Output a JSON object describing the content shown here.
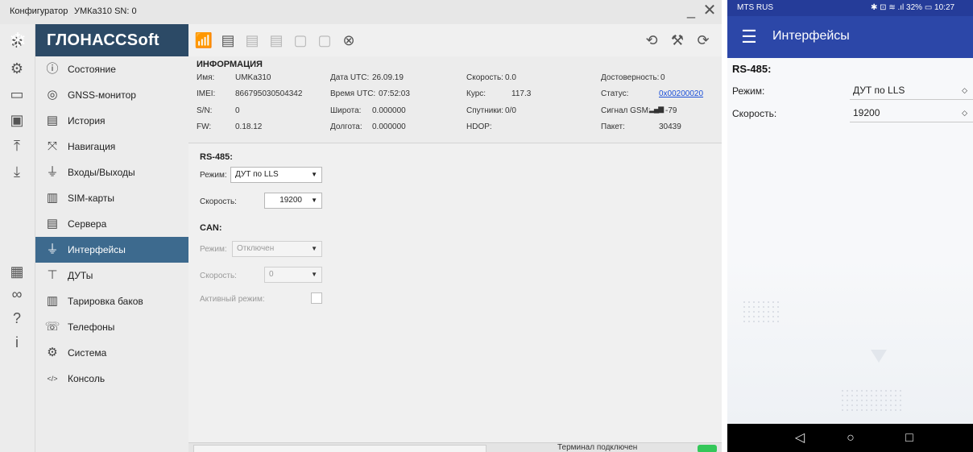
{
  "window": {
    "title_app": "Конфигуратор",
    "title_device": "УМКа310 SN: 0",
    "minimize_glyph": "_",
    "close_glyph": "✕"
  },
  "brand": {
    "name": "ГЛОНАССSoft",
    "logo_glyph": "❄"
  },
  "rail_icons": [
    {
      "name": "bluetooth-icon",
      "glyph": "✱"
    },
    {
      "name": "usb-icon",
      "glyph": "⚙"
    },
    {
      "name": "folder-icon",
      "glyph": "▭"
    },
    {
      "name": "save-icon",
      "glyph": "▣"
    },
    {
      "name": "upload-icon",
      "glyph": "⤒"
    },
    {
      "name": "download-icon",
      "glyph": "⤓"
    },
    {
      "name": "grid-icon",
      "glyph": "▦"
    },
    {
      "name": "link-icon",
      "glyph": "∞"
    },
    {
      "name": "help-icon",
      "glyph": "?"
    },
    {
      "name": "about-icon",
      "glyph": "i"
    }
  ],
  "sidebar": {
    "items": [
      {
        "label": "Состояние",
        "icon": "info-icon",
        "glyph": "ⓘ"
      },
      {
        "label": "GNSS-монитор",
        "icon": "satellite-icon",
        "glyph": "◎"
      },
      {
        "label": "История",
        "icon": "book-icon",
        "glyph": "▤"
      },
      {
        "label": "Навигация",
        "icon": "navigation-icon",
        "glyph": "⤧"
      },
      {
        "label": "Входы/Выходы",
        "icon": "io-icon",
        "glyph": "⏚"
      },
      {
        "label": "SIM-карты",
        "icon": "sim-icon",
        "glyph": "▥"
      },
      {
        "label": "Сервера",
        "icon": "server-icon",
        "glyph": "▤"
      },
      {
        "label": "Интерфейсы",
        "icon": "interface-icon",
        "glyph": "⏚"
      },
      {
        "label": "ДУТы",
        "icon": "sensor-icon",
        "glyph": "⊤"
      },
      {
        "label": "Тарировка баков",
        "icon": "tank-icon",
        "glyph": "▥"
      },
      {
        "label": "Телефоны",
        "icon": "phone-icon",
        "glyph": "☏"
      },
      {
        "label": "Система",
        "icon": "gear-icon",
        "glyph": "⚙"
      },
      {
        "label": "Консоль",
        "icon": "console-icon",
        "glyph": "</>"
      }
    ],
    "active_index": 7
  },
  "toolbar": {
    "left_icons": [
      {
        "name": "gsm-antenna-icon",
        "glyph": "📶",
        "dim": false
      },
      {
        "name": "read-config-icon",
        "glyph": "▤",
        "dim": false
      },
      {
        "name": "write-config-icon",
        "glyph": "▤",
        "dim": true
      },
      {
        "name": "apply-config-icon",
        "glyph": "▤",
        "dim": true
      },
      {
        "name": "db-read-icon",
        "glyph": "▢",
        "dim": true
      },
      {
        "name": "db-settings-icon",
        "glyph": "▢",
        "dim": true
      },
      {
        "name": "location-off-icon",
        "glyph": "⊗",
        "dim": false
      }
    ],
    "right_icons": [
      {
        "name": "reload-icon",
        "glyph": "⟲"
      },
      {
        "name": "firmware-icon",
        "glyph": "⚒"
      },
      {
        "name": "restore-icon",
        "glyph": "⟳"
      }
    ]
  },
  "info": {
    "title": "ИНФОРМАЦИЯ",
    "col1": [
      {
        "label": "Имя:",
        "value": "UMKa310"
      },
      {
        "label": "IMEI:",
        "value": "866795030504342"
      },
      {
        "label": "S/N:",
        "value": "0"
      },
      {
        "label": "FW:",
        "value": "0.18.12"
      }
    ],
    "col2": [
      {
        "label": "Дата UTC:",
        "value": "26.09.19"
      },
      {
        "label": "Время UTC:",
        "value": "07:52:03"
      },
      {
        "label": "Широта:",
        "value": "0.000000"
      },
      {
        "label": "Долгота:",
        "value": "0.000000"
      }
    ],
    "col3": [
      {
        "label": "Скорость:",
        "value": "0.0"
      },
      {
        "label": "Курс:",
        "value": "117.3"
      },
      {
        "label": "Спутники:",
        "value": "0/0"
      },
      {
        "label": "HDOP:",
        "value": ""
      }
    ],
    "col4": [
      {
        "label": "Достоверность:",
        "value": "0"
      },
      {
        "label": "Статус:",
        "value": "0x00200020"
      },
      {
        "label": "Сигнал GSM:",
        "value": "-79",
        "signal_glyph": "▂▄▆"
      },
      {
        "label": "Пакет:",
        "value": "30439"
      }
    ]
  },
  "rs485": {
    "title": "RS-485:",
    "mode_label": "Режим:",
    "mode_value": "ДУТ по LLS",
    "speed_label": "Скорость:",
    "speed_value": "19200"
  },
  "can": {
    "title": "CAN:",
    "mode_label": "Режим:",
    "mode_value": "Отключен",
    "speed_label": "Скорость:",
    "speed_value": "0",
    "active_label": "Активный режим:",
    "active_checked": false
  },
  "status": {
    "text": "Терминал подключен",
    "led_color": "#34c759"
  },
  "mobile": {
    "carrier": "MTS RUS",
    "status_right": "✱ ⊡ ≋ .ıl 32% ▭ 10:27",
    "menu_glyph": "☰",
    "title": "Интерфейсы",
    "section": "RS-485:",
    "mode_label": "Режим:",
    "mode_value": "ДУТ по LLS",
    "speed_label": "Скорость:",
    "speed_value": "19200",
    "nav_back": "◁",
    "nav_home": "○",
    "nav_recent": "□"
  },
  "colors": {
    "accent_dark": "#2c4a66",
    "active_nav": "#3d6a8e",
    "mobile_bar": "#2c47a8",
    "link": "#1a4fd8"
  }
}
